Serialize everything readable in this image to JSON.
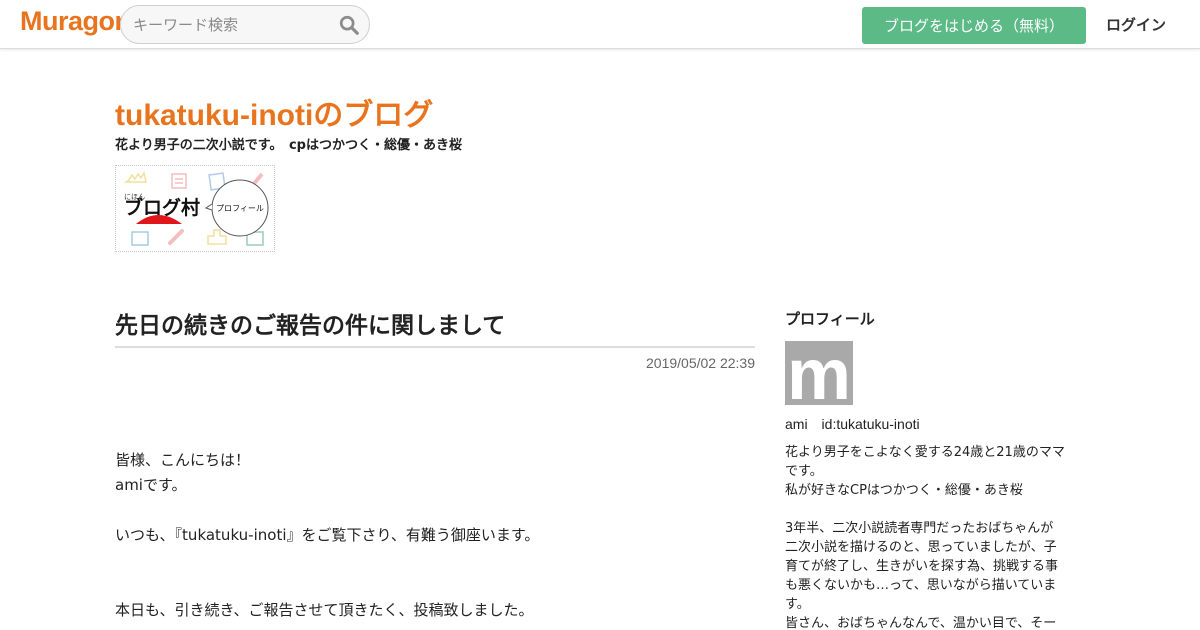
{
  "header": {
    "logo_text": "Muragon",
    "search_placeholder": "キーワード検索",
    "start_button": "ブログをはじめる（無料）",
    "login": "ログイン",
    "accent_color": "#e8741e",
    "button_color": "#5bba86"
  },
  "blog": {
    "title": "tukatuku-inotiのブログ",
    "description": "花より男子の二次小説です。　cpはつかつく・総優・あき桜",
    "banner": {
      "small_label": "にほん",
      "main_label": "ブログ村",
      "bubble_label": "プロフィール"
    }
  },
  "post": {
    "title": "先日の続きのご報告の件に関しまして",
    "date": "2019/05/02 22:39",
    "lines": {
      "greeting": "皆様、こんにちは！",
      "name": "amiです。",
      "thanks": "いつも、『tukatuku-inoti』をご覧下さり、有難う御座います。",
      "report": "本日も、引き続き、ご報告させて頂きたく、投稿致しました。"
    }
  },
  "sidebar": {
    "heading": "プロフィール",
    "avatar_letter": "m",
    "user_line": "ami　id:tukatuku-inoti",
    "bio": [
      "花より男子をこよなく愛する24歳と21歳のママ",
      "です。",
      "私が好きなCPはつかつく・総優・あき桜",
      "",
      "3年半、二次小説読者専門だったおばちゃんが",
      "二次小説を描けるのと、思っていましたが、子",
      "育てが終了し、生きがいを探す為、挑戦する事",
      "も悪くないかも…って、思いながら描いていま",
      "す。",
      "皆さん、おばちゃんなんで、温かい目で、そー"
    ]
  }
}
